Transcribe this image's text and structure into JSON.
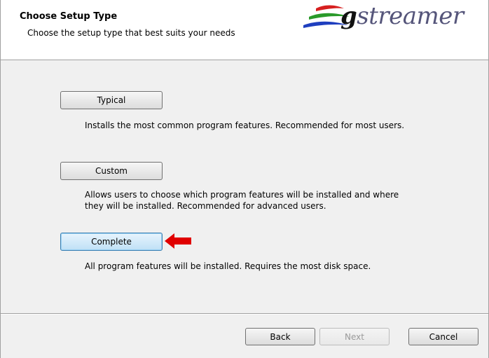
{
  "header": {
    "title": "Choose Setup Type",
    "subtitle": "Choose the setup type that best suits your needs",
    "logo_text_first": "g",
    "logo_text_rest": "streamer"
  },
  "options": [
    {
      "label": "Typical",
      "description": "Installs the most common program features. Recommended for most users."
    },
    {
      "label": "Custom",
      "description_line1": "Allows users to choose which program features will be installed and where",
      "description_line2": "they will be installed. Recommended for advanced users."
    },
    {
      "label": "Complete",
      "description": "All program features will be installed. Requires the most disk space."
    }
  ],
  "footer": {
    "back_label": "Back",
    "next_label": "Next",
    "cancel_label": "Cancel"
  },
  "colors": {
    "arrow": "#e00000",
    "focus_border": "#3c7fb1"
  }
}
